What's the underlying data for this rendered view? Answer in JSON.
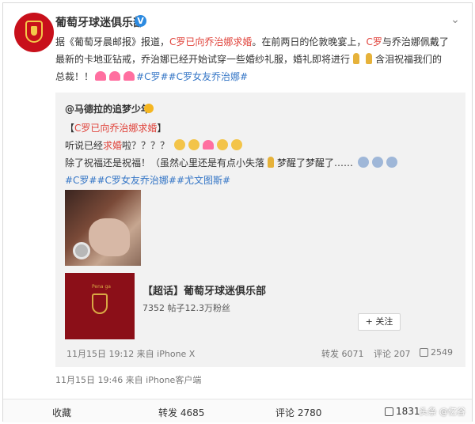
{
  "post": {
    "author": "葡萄牙球迷俱乐部",
    "verified_badge": "V",
    "text": {
      "p1": "据《葡萄牙晨邮报》报道，",
      "c1": "C罗已向乔治娜",
      "c1b": "求婚",
      "p2": "。在前两日的伦敦晚宴上，",
      "c2": "C罗",
      "p3": "与乔治娜佩戴了最新的卡地亚钻戒，乔治娜已经开始试穿一些婚纱礼服，婚礼即将进行",
      "p4": "含泪祝福我们的总裁！！",
      "tag1": "#C罗#",
      "tag2": "#C罗女友乔治娜#"
    },
    "time": "11月15日 19:46 来自 iPhone客户端"
  },
  "repost": {
    "author": "@马德拉的追梦少年",
    "line1": {
      "open": "【",
      "red": "C罗已向乔治娜",
      "red2": "求婚",
      "close": "】"
    },
    "line2": {
      "a": "听说已经",
      "red": "求婚",
      "b": "啦？？？？"
    },
    "line3": "除了祝福还是祝福！（虽然心里还是有点小失落",
    "line3b": "梦醒了梦醒了……",
    "tags": "#C罗##C罗女友乔治娜##尤文图斯#",
    "card": {
      "title": "【超话】葡萄牙球迷俱乐部",
      "stats": "7352 帖子12.3万粉丝",
      "follow": "+ 关注",
      "thumb_text": "Pena ga"
    },
    "footer": {
      "time": "11月15日 19:12 来自 iPhone X",
      "forward": "转发 6071",
      "comment": "评论 207",
      "like": "2549"
    }
  },
  "bottom_bar": {
    "favorite": "收藏",
    "forward": "转发 4685",
    "comment": "评论 2780",
    "like": "1831"
  },
  "watermark": "头条 @亿谷"
}
